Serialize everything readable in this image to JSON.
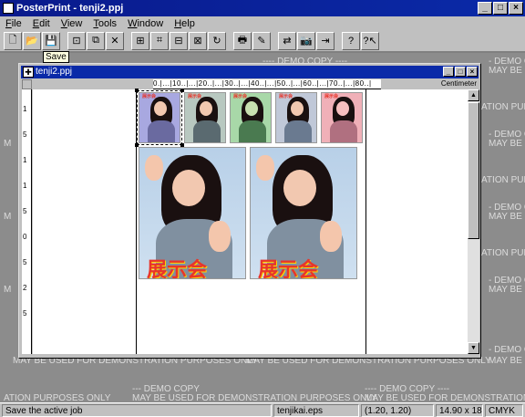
{
  "app": {
    "title": "PosterPrint - tenji2.ppj"
  },
  "window_buttons": {
    "minimize": "_",
    "maximize": "□",
    "close": "×"
  },
  "menu": [
    {
      "key": "F",
      "rest": "ile"
    },
    {
      "key": "E",
      "rest": "dit"
    },
    {
      "key": "V",
      "rest": "iew"
    },
    {
      "key": "T",
      "rest": "ools"
    },
    {
      "key": "W",
      "rest": "indow"
    },
    {
      "key": "H",
      "rest": "elp"
    }
  ],
  "toolbar": {
    "new": "🗋",
    "open": "📂",
    "save": "💾",
    "b4": "⊡",
    "b5": "⧉",
    "b6": "✕",
    "b7": "⊞",
    "b8": "⌗",
    "b9": "⊟",
    "b10": "⊠",
    "b11": "↻",
    "print": "🖶",
    "b13": "✎",
    "b14": "⇄",
    "b15": "📷",
    "b16": "⇥",
    "help": "?",
    "context_help": "?↖"
  },
  "tooltip": "Save",
  "watermark": {
    "demo": "---- DEMO COPY ----",
    "use": "MAY BE USED FOR DEMONSTRATION PURPOSES ONLY",
    "demo_short": "- DEMO C",
    "use_short": "MAY BE USED F",
    "ation": "ATION PURPOSES ONLY",
    "demo_copy": "--- DEMO COPY",
    "mini": "M"
  },
  "doc": {
    "title": "tenji2.ppj",
    "units": "Centimeter",
    "hruler": "0.|...|10..|...|20..|...|30..|...|40..|...|50..|...|60..|...|70..|...|80..|",
    "vruler": [
      "1",
      "5",
      "1",
      "1",
      "5",
      "0",
      "5",
      "2",
      "5"
    ]
  },
  "poster": {
    "caption": "展示会",
    "thumb_caption": "展示会"
  },
  "scroll": {
    "up": "▲",
    "down": "▼"
  },
  "status": {
    "message": "Save the active job",
    "file": "tenjikai.eps",
    "position": "(1.20, 1.20)",
    "size": "14.90 x 18.64",
    "mode": "CMYK"
  },
  "colors": {
    "title_bar": "#0a2aa8",
    "chrome": "#c0c0c0",
    "workspace": "#8c8c8c"
  }
}
